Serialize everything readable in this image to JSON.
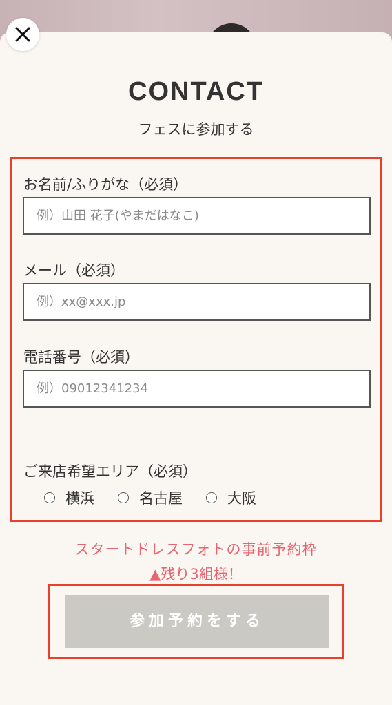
{
  "header": {
    "close_icon": "close-icon",
    "title": "CONTACT",
    "subtitle": "フェスに参加する"
  },
  "form": {
    "name_label": "お名前/ふりがな（必須）",
    "name_placeholder": "例）山田 花子(やまだはなこ)",
    "name_value": "",
    "email_label": "メール（必須）",
    "email_placeholder": "例）xx@xxx.jp",
    "email_value": "",
    "phone_label": "電話番号（必須）",
    "phone_placeholder": "例）09012341234",
    "phone_value": "",
    "area_label": "ご来店希望エリア（必須）",
    "area_options": [
      "横浜",
      "名古屋",
      "大阪"
    ]
  },
  "notice": {
    "line1": "スタートドレスフォトの事前予約枠",
    "line2": "▲残り3組様！"
  },
  "submit": {
    "label": "参加予約をする"
  },
  "colors": {
    "highlight_border": "#e8402a",
    "notice_text": "#e86470",
    "submit_bg": "#cbc9c4",
    "sheet_bg": "#faf6f1"
  }
}
